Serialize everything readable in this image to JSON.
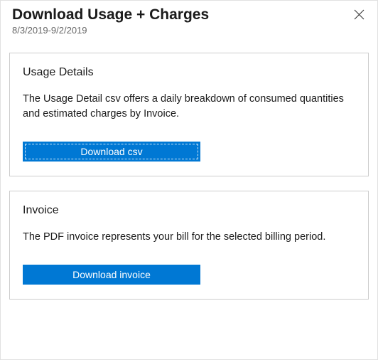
{
  "header": {
    "title": "Download Usage + Charges",
    "date_range": "8/3/2019-9/2/2019"
  },
  "cards": {
    "usage": {
      "title": "Usage Details",
      "description": "The Usage Detail csv offers a daily breakdown of consumed quantities and estimated charges by Invoice.",
      "button": "Download csv"
    },
    "invoice": {
      "title": "Invoice",
      "description": "The PDF invoice represents your bill for the selected billing period.",
      "button": "Download invoice"
    }
  }
}
